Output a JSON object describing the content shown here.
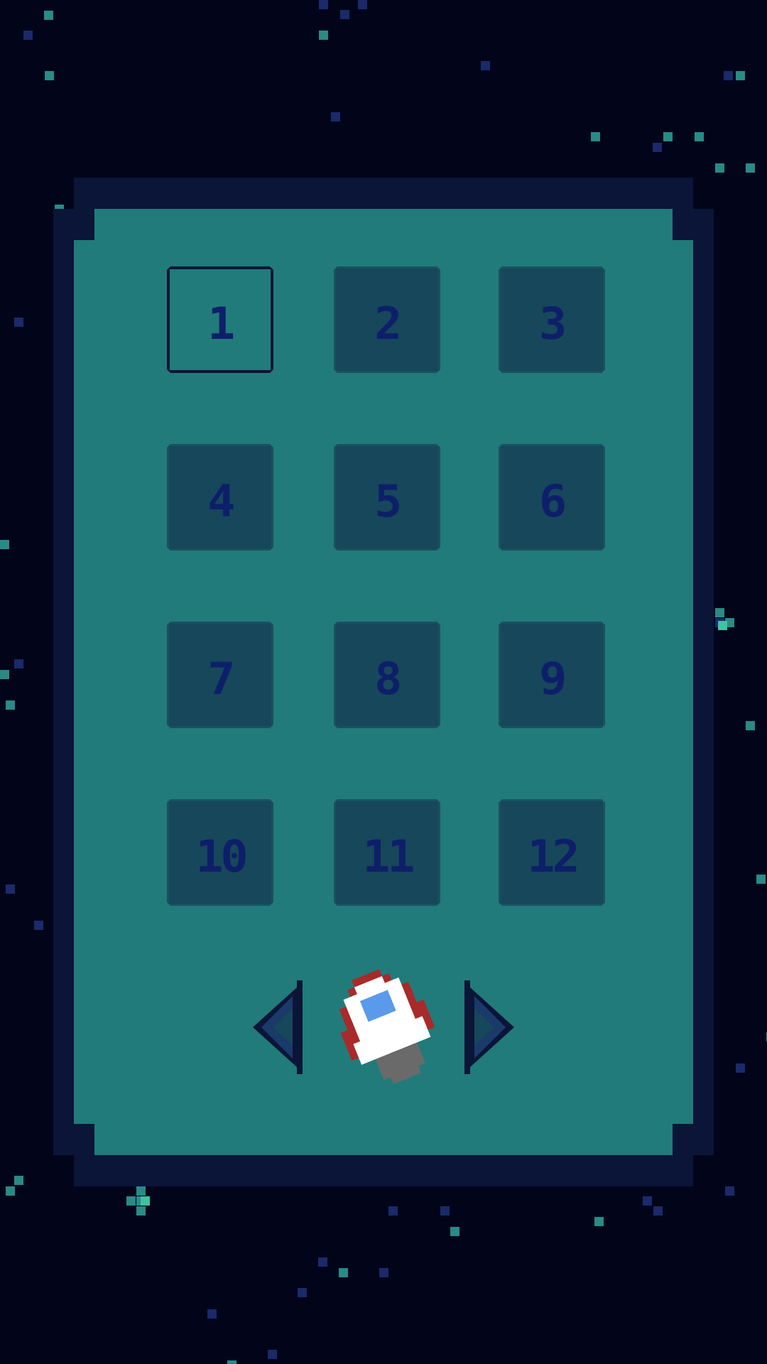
{
  "screen": "level-select",
  "selected_level": "1",
  "levels": [
    {
      "label": "1"
    },
    {
      "label": "2"
    },
    {
      "label": "3"
    },
    {
      "label": "4"
    },
    {
      "label": "5"
    },
    {
      "label": "6"
    },
    {
      "label": "7"
    },
    {
      "label": "8"
    },
    {
      "label": "9"
    },
    {
      "label": "10"
    },
    {
      "label": "11"
    },
    {
      "label": "12"
    }
  ],
  "ship_selector": {
    "prev_icon": "arrow-left-icon",
    "next_icon": "arrow-right-icon",
    "ship_icon": "rocket-ship-icon"
  },
  "colors": {
    "space": "#02051a",
    "frame": "#0a1538",
    "panel": "#217b7a",
    "button": "#16475a",
    "number": "#0e1f6a",
    "star_teal": "#2a8a86",
    "star_navy": "#1a2a6a",
    "ship_white": "#ffffff",
    "ship_red": "#a82a2a",
    "ship_window": "#5a9aea",
    "ship_grey": "#6a6a6a"
  }
}
